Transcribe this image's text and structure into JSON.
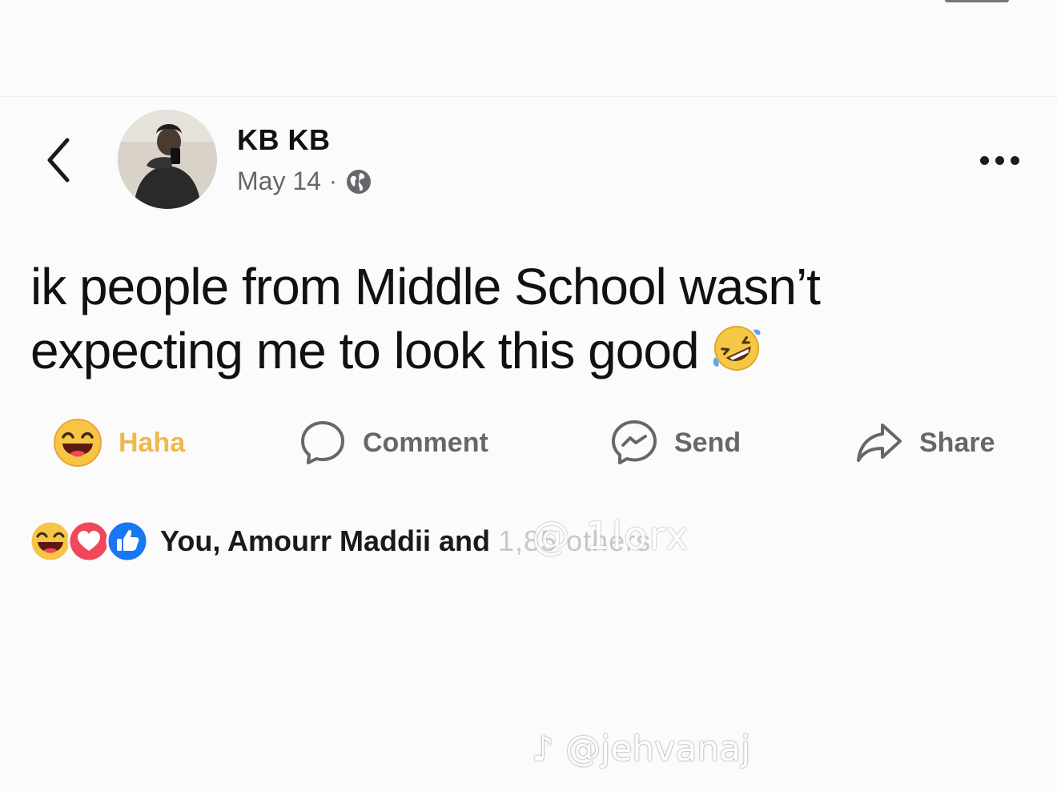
{
  "post": {
    "author_name": "KB KB",
    "date": "May 14",
    "separator": "·",
    "audience_icon": "globe-icon",
    "text_line_1": "ik people from Middle School wasn’t",
    "text_line_2": "expecting me to look this good",
    "text_emoji": "rolling-on-floor-laughing-emoji"
  },
  "header": {
    "back_icon": "chevron-left-icon",
    "more_icon": "ellipsis-icon"
  },
  "actions": {
    "haha_label": "Haha",
    "comment_label": "Comment",
    "send_label": "Send",
    "share_label": "Share"
  },
  "reactions": {
    "icons": [
      "haha-icon",
      "love-icon",
      "like-icon"
    ],
    "summary_text": "You, Amourr Maddii and",
    "summary_faded": "1,85 others"
  },
  "watermarks": {
    "overlay": "@ 1lorx",
    "handle": "@jehvanaj"
  },
  "colors": {
    "haha_accent": "#f1b849",
    "action_gray": "#65676b",
    "like_blue": "#1877f2",
    "love_red": "#f0475a"
  }
}
